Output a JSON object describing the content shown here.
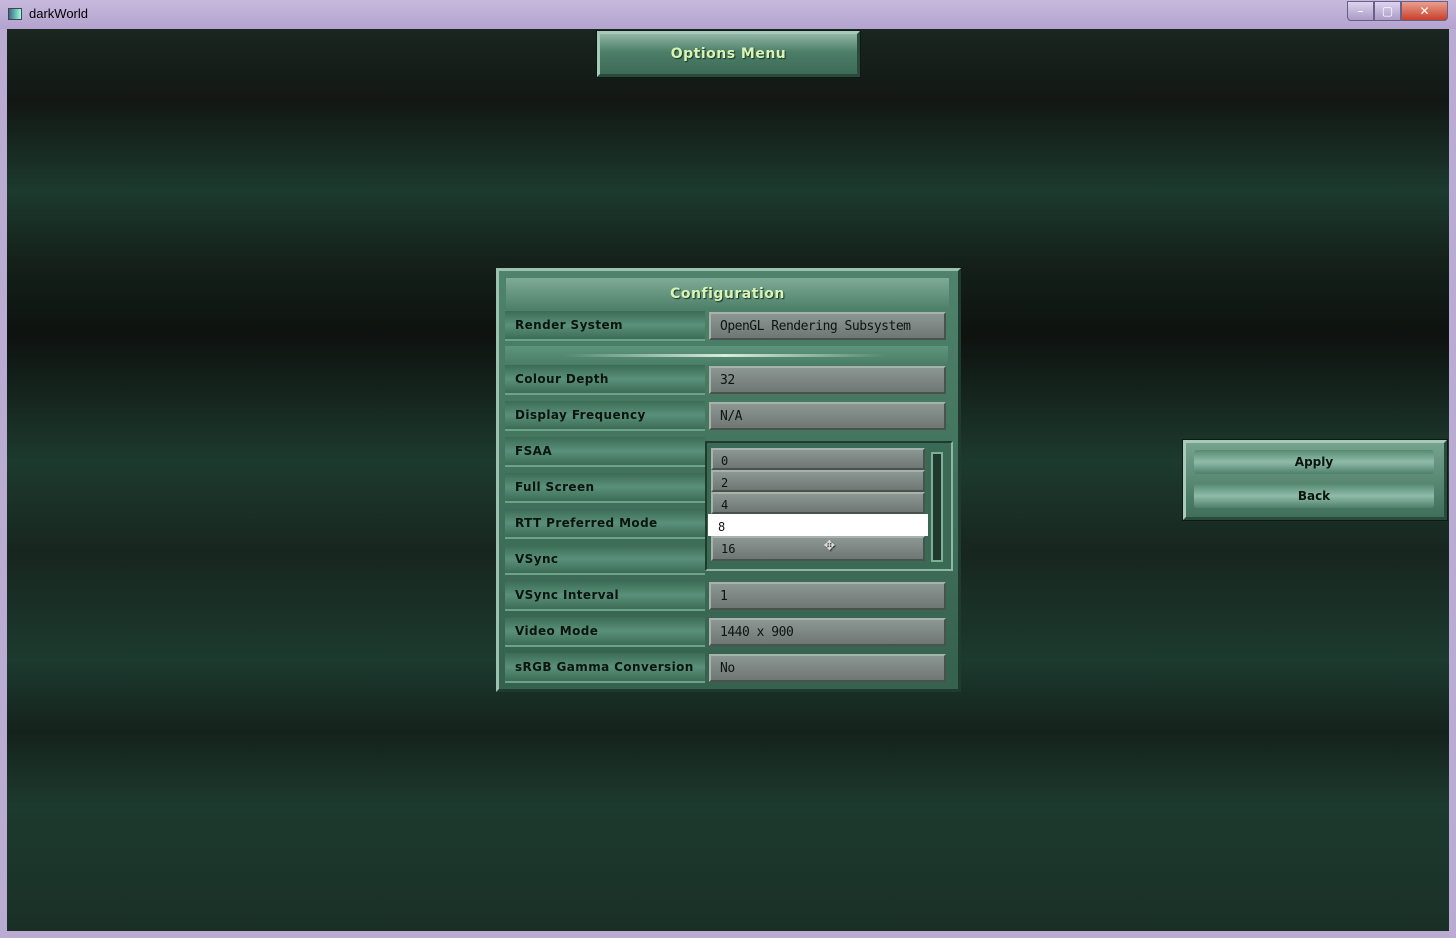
{
  "window": {
    "title": "darkWorld",
    "controls": {
      "minimize": "–",
      "maximize": "▢",
      "close": "✕"
    }
  },
  "header": {
    "title": "Options Menu"
  },
  "config": {
    "title": "Configuration",
    "rows": [
      {
        "label": "Render System",
        "value": "OpenGL Rendering Subsystem"
      },
      {
        "label": "Colour Depth",
        "value": "32"
      },
      {
        "label": "Display Frequency",
        "value": "N/A"
      },
      {
        "label": "FSAA"
      },
      {
        "label": "Full Screen"
      },
      {
        "label": "RTT Preferred Mode"
      },
      {
        "label": "VSync"
      },
      {
        "label": "VSync Interval",
        "value": "1"
      },
      {
        "label": "Video Mode",
        "value": "1440 x 900"
      },
      {
        "label": "sRGB Gamma Conversion",
        "value": "No"
      }
    ],
    "fsaa_dropdown": {
      "options": [
        "0",
        "2",
        "4",
        "8",
        "16"
      ],
      "highlighted": "8"
    }
  },
  "buttons": {
    "apply": "Apply",
    "back": "Back"
  },
  "colors": {
    "accent_text": "#d8f5b4",
    "panel": "#4f836b",
    "background": "#142019"
  }
}
